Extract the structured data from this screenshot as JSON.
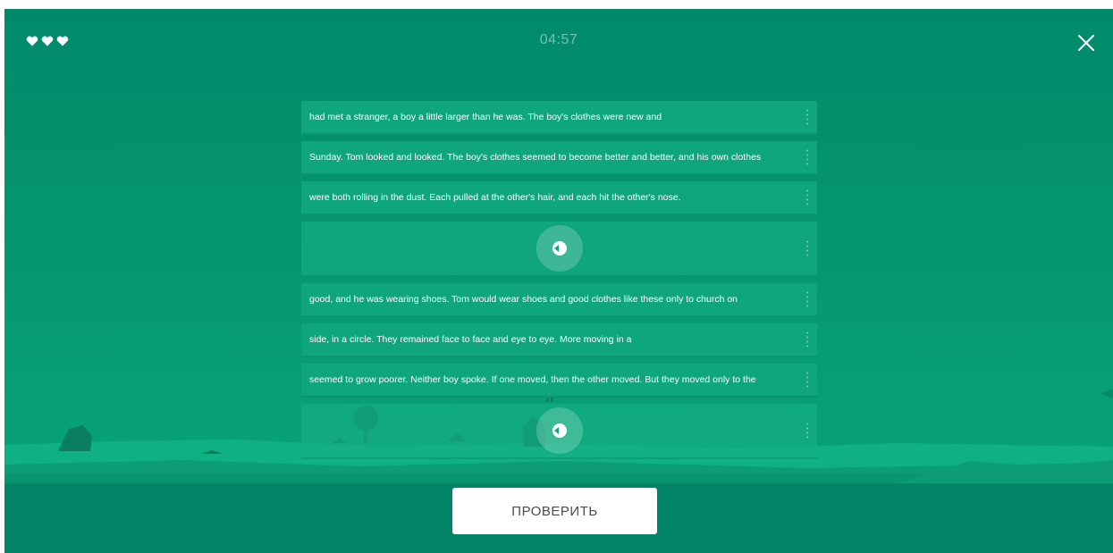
{
  "header": {
    "lives": 3,
    "heart_icons": [
      "heart-icon",
      "heart-icon",
      "heart-icon"
    ],
    "timer": "04:57",
    "close_icon": "close-icon"
  },
  "sentences": [
    {
      "type": "text",
      "text": "had met a stranger, a boy a little larger than he was. The boy's clothes were new and"
    },
    {
      "type": "text",
      "text": "Sunday. Tom looked and looked. The boy's clothes seemed to become better and better, and his own clothes"
    },
    {
      "type": "text",
      "text": "were both rolling in the dust. Each pulled at the other's hair, and each hit the other's nose."
    },
    {
      "type": "audio",
      "icon": "speaker-icon"
    },
    {
      "type": "text",
      "text": "good, and he was wearing shoes. Tom would wear shoes and good clothes like these only to church on"
    },
    {
      "type": "text",
      "text": "side, in a circle. They remained face to face and eye to eye. More moving in a"
    },
    {
      "type": "text",
      "text": "seemed to grow poorer. Neither boy spoke. If one moved, then the other moved. But they moved only to the"
    },
    {
      "type": "audio",
      "icon": "speaker-icon"
    }
  ],
  "footer": {
    "check_label": "ПРОВЕРИТЬ"
  },
  "colors": {
    "background": "#008a6a",
    "row": "#0fa57d",
    "footer": "#018566",
    "button": "#ffffff"
  }
}
